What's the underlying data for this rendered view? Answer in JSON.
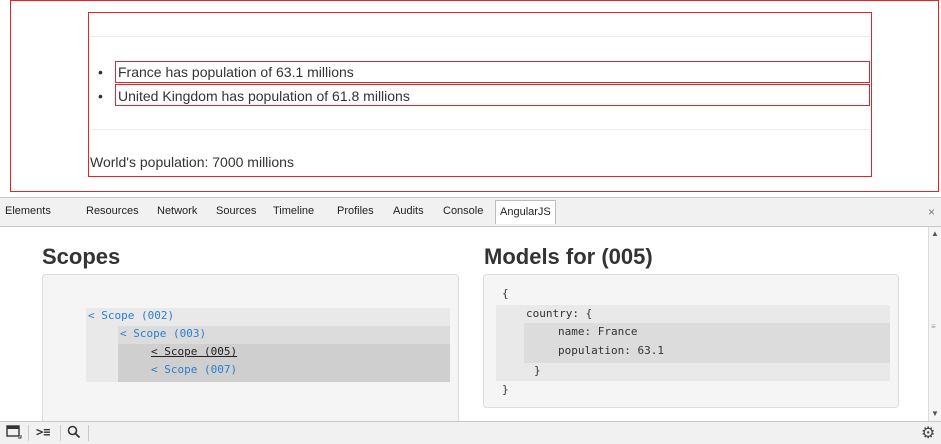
{
  "page": {
    "list_items": [
      "France has population of 63.1 millions",
      "United Kingdom has population of 61.8 millions"
    ],
    "world_population": "World's population: 7000 millions"
  },
  "devtools": {
    "tabs": [
      "Elements",
      "Resources",
      "Network",
      "Sources",
      "Timeline",
      "Profiles",
      "Audits",
      "Console",
      "AngularJS"
    ],
    "active_tab": "AngularJS",
    "close_glyph": "×",
    "scopes_title": "Scopes",
    "scopes": [
      {
        "label": "< Scope (002)",
        "depth": 0,
        "selected": false
      },
      {
        "label": "< Scope (003)",
        "depth": 1,
        "selected": false
      },
      {
        "label": "< Scope (005)",
        "depth": 2,
        "selected": true
      },
      {
        "label": "< Scope (007)",
        "depth": 2,
        "selected": false
      }
    ],
    "models_title": "Models for (005)",
    "models_lines": [
      "{",
      "country:  {",
      "name: France",
      "population: 63.1",
      "}",
      "}"
    ],
    "bottom_icons": [
      "dock-icon",
      "console-drawer-icon",
      "search-icon",
      "settings-gear-icon"
    ]
  },
  "colors": {
    "highlight": "#e0262b",
    "scope_link": "#2a7fd1"
  }
}
